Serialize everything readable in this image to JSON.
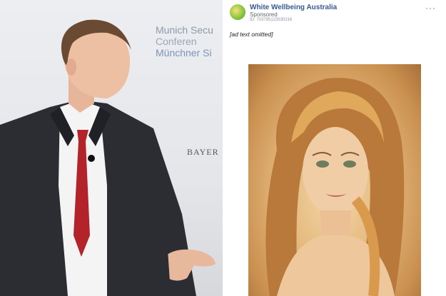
{
  "photo": {
    "backdrop_lines": [
      "Munich Secu",
      "Conferen",
      "Münchner Si"
    ],
    "sponsor_mark": "BAYER"
  },
  "ad": {
    "page_name": "White Wellbeing Australia",
    "sponsored_label": "Sponsored",
    "ad_id": "ID: 703795123530216",
    "more_icon": "···",
    "caption_placeholder": "[ad text omitted]"
  },
  "colors": {
    "link_blue": "#385898",
    "tie_red": "#b3242a",
    "suit_dark": "#2b2d33"
  }
}
